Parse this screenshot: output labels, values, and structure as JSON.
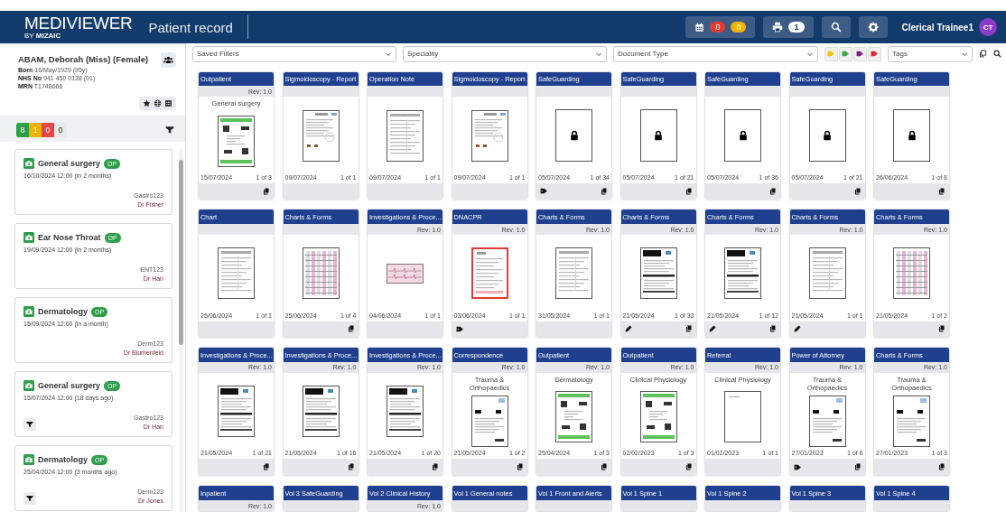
{
  "header": {
    "logo": "**MEDI**VIEWER",
    "logo_sub": "BY **MIZAIC**",
    "title": "Patient record",
    "calendar_badges": [
      {
        "count": "0",
        "color": "#e53935"
      },
      {
        "count": "0",
        "color": "#f0b400"
      }
    ],
    "print_badge": "1",
    "user": "Clerical Trainee1",
    "avatar": "CT"
  },
  "patient": {
    "name": "ABAM, Deborah (Miss) (Female)",
    "fields": [
      {
        "label": "Born",
        "value": "16/May/1929 (95y)"
      },
      {
        "label": "NHS No",
        "value": "941 450 0138 (01)"
      },
      {
        "label": "MRN",
        "value": "T1748666"
      }
    ]
  },
  "status_counts": [
    {
      "count": "8",
      "color": "#2e9e4a"
    },
    {
      "count": "1",
      "color": "#f0b400"
    },
    {
      "count": "0",
      "color": "#e84545"
    },
    {
      "count": "0",
      "color": "#e8e8e8"
    }
  ],
  "appointments": [
    {
      "title": "General surgery",
      "badge": "OP",
      "date": "16/10/2024 12:00 (in 2 months)",
      "code": "Gastro123",
      "doctor": "Dr Fisher",
      "filter": false
    },
    {
      "title": "Ear Nose Throat",
      "badge": "OP",
      "date": "19/09/2024 12:00 (in 2 months)",
      "code": "ENT123",
      "doctor": "Dr Han",
      "filter": false
    },
    {
      "title": "Dermatology",
      "badge": "OP",
      "date": "15/09/2024 12:00 (in a month)",
      "code": "Derm123",
      "doctor": "Dr Blumenfeld",
      "filter": false
    },
    {
      "title": "General surgery",
      "badge": "OP",
      "date": "15/07/2024 12:00 (18 days ago)",
      "code": "Gastro123",
      "doctor": "Dr Han",
      "filter": true
    },
    {
      "title": "Dermatology",
      "badge": "OP",
      "date": "25/04/2024 12:00 (3 months ago)",
      "code": "Derm123",
      "doctor": "Dr Jones",
      "filter": true
    }
  ],
  "filters": {
    "saved_filters": "Saved Filters",
    "speciality": "Speciality",
    "document_type": "Document Type",
    "tag_filters": [
      {
        "color": "#f2c200"
      },
      {
        "color": "#3fa64a"
      },
      {
        "color": "#8a1a8a"
      },
      {
        "color": "#e0243a"
      }
    ],
    "tags": "Tags"
  },
  "documents": [
    {
      "title": "Outpatient",
      "rev": "Rev: 1.0",
      "subtitle": "General surgery",
      "kind": "outpatient",
      "date": "15/07/2024",
      "pages": "1 of 3",
      "tagged": false,
      "annotated": false,
      "multi_page": true
    },
    {
      "title": "Sigmoidoscopy - Report",
      "kind": "report",
      "date": "09/07/2024",
      "pages": "1 of 1",
      "tagged": false,
      "annotated": false,
      "multi_page": false
    },
    {
      "title": "Operation Note",
      "kind": "form",
      "date": "09/07/2024",
      "pages": "1 of 1",
      "tagged": false,
      "annotated": false,
      "multi_page": false
    },
    {
      "title": "Sigmoidoscopy - Report",
      "kind": "report",
      "date": "09/07/2024",
      "pages": "1 of 1",
      "tagged": false,
      "annotated": false,
      "multi_page": false
    },
    {
      "title": "SafeGuarding",
      "kind": "locked",
      "date": "05/07/2024",
      "pages": "1 of 34",
      "tagged": true,
      "annotated": false,
      "multi_page": true
    },
    {
      "title": "SafeGuarding",
      "kind": "locked",
      "date": "05/07/2024",
      "pages": "1 of 21",
      "tagged": false,
      "annotated": false,
      "multi_page": true
    },
    {
      "title": "SafeGuarding",
      "kind": "locked",
      "date": "05/07/2024",
      "pages": "1 of 36",
      "tagged": false,
      "annotated": false,
      "multi_page": true
    },
    {
      "title": "SafeGuarding",
      "kind": "locked",
      "date": "05/07/2024",
      "pages": "1 of 21",
      "tagged": false,
      "annotated": false,
      "multi_page": true
    },
    {
      "title": "SafeGuarding",
      "kind": "locked",
      "date": "26/06/2024",
      "pages": "1 of 8",
      "tagged": false,
      "annotated": false,
      "multi_page": true
    },
    {
      "title": "Chart",
      "kind": "form",
      "date": "25/06/2024",
      "pages": "1 of 1",
      "tagged": false,
      "annotated": false,
      "multi_page": false
    },
    {
      "title": "Charts & Forms",
      "kind": "table",
      "date": "25/06/2024",
      "pages": "1 of 4",
      "tagged": false,
      "annotated": false,
      "multi_page": true
    },
    {
      "title": "Investigations & Proce...",
      "rev": "Rev: 1.0",
      "kind": "ecg",
      "date": "04/06/2024",
      "pages": "1 of 1",
      "tagged": false,
      "annotated": false,
      "multi_page": false
    },
    {
      "title": "DNACPR",
      "rev": "Rev: 1.0",
      "kind": "dnacpr",
      "date": "03/06/2024",
      "pages": "1 of 1",
      "tagged": true,
      "annotated": false,
      "multi_page": false
    },
    {
      "title": "Charts & Forms",
      "rev": "Rev: 1.0",
      "kind": "form",
      "date": "31/05/2024",
      "pages": "1 of 1",
      "tagged": false,
      "annotated": false,
      "multi_page": false
    },
    {
      "title": "Charts & Forms",
      "rev": "Rev: 1.0",
      "kind": "blackform",
      "date": "21/05/2024",
      "pages": "1 of 33",
      "tagged": false,
      "annotated": true,
      "multi_page": true
    },
    {
      "title": "Charts & Forms",
      "rev": "Rev: 1.0",
      "kind": "blackform",
      "date": "21/05/2024",
      "pages": "1 of 12",
      "tagged": false,
      "annotated": true,
      "multi_page": true
    },
    {
      "title": "Charts & Forms",
      "rev": "Rev: 1.0",
      "kind": "form",
      "date": "21/05/2024",
      "pages": "1 of 1",
      "tagged": false,
      "annotated": true,
      "multi_page": false
    },
    {
      "title": "Charts & Forms",
      "rev": "Rev: 1.0",
      "kind": "table",
      "date": "21/05/2024",
      "pages": "1 of 2",
      "tagged": false,
      "annotated": false,
      "multi_page": true
    },
    {
      "title": "Investigations & Proce...",
      "rev": "Rev: 1.0",
      "kind": "blackform",
      "date": "21/05/2024",
      "pages": "1 of 21",
      "tagged": false,
      "annotated": false,
      "multi_page": true
    },
    {
      "title": "Investigations & Proce...",
      "rev": "Rev: 1.0",
      "kind": "blackform",
      "date": "21/05/2024",
      "pages": "1 of 16",
      "tagged": false,
      "annotated": false,
      "multi_page": true
    },
    {
      "title": "Investigations & Proce...",
      "rev": "Rev: 1.0",
      "kind": "blackform",
      "date": "21/05/2024",
      "pages": "1 of 20",
      "tagged": false,
      "annotated": false,
      "multi_page": true
    },
    {
      "title": "Correspondence",
      "rev": "Rev: 1.0",
      "subtitle": "Trauma & Orthopaedics",
      "kind": "letter",
      "date": "21/05/2024",
      "pages": "1 of 2",
      "tagged": false,
      "annotated": false,
      "multi_page": true
    },
    {
      "title": "Outpatient",
      "rev": "Rev: 1.0",
      "subtitle": "Dermatology",
      "kind": "outpatient",
      "date": "25/04/2024",
      "pages": "1 of 3",
      "tagged": false,
      "annotated": false,
      "multi_page": true
    },
    {
      "title": "Outpatient",
      "rev": "Rev: 1.0",
      "subtitle": "Clinical Physiology",
      "kind": "outpatient",
      "date": "02/02/2023",
      "pages": "1 of 3",
      "tagged": false,
      "annotated": false,
      "multi_page": true
    },
    {
      "title": "Referral",
      "rev": "Rev: 1.0",
      "subtitle": "Clinical Physiology",
      "kind": "blank",
      "date": "01/02/2023",
      "pages": "1 of 1",
      "tagged": false,
      "annotated": false,
      "multi_page": false
    },
    {
      "title": "Power of Attorney",
      "rev": "Rev: 1.0",
      "subtitle": "Trauma & Orthopaedics",
      "kind": "letter",
      "date": "27/01/2023",
      "pages": "1 of 6",
      "tagged": true,
      "annotated": false,
      "multi_page": true
    },
    {
      "title": "Charts & Forms",
      "rev": "Rev: 1.0",
      "subtitle": "Trauma & Orthopaedics",
      "kind": "letter",
      "date": "27/01/2023",
      "pages": "1 of 3",
      "tagged": false,
      "annotated": false,
      "multi_page": true
    },
    {
      "title": "Inpatient",
      "rev": "Rev: 1.0"
    },
    {
      "title": "Vol 3 SafeGuarding"
    },
    {
      "title": "Vol 2 Clinical History",
      "rev": "Rev: 1.0"
    },
    {
      "title": "Vol 1 General notes"
    },
    {
      "title": "Vol 1 Front and Alerts"
    },
    {
      "title": "Vol 1 Spine 1"
    },
    {
      "title": "Vol 1 Spine 2"
    },
    {
      "title": "Vol 1 Spine 3"
    },
    {
      "title": "Vol 1 Spine 4"
    }
  ]
}
